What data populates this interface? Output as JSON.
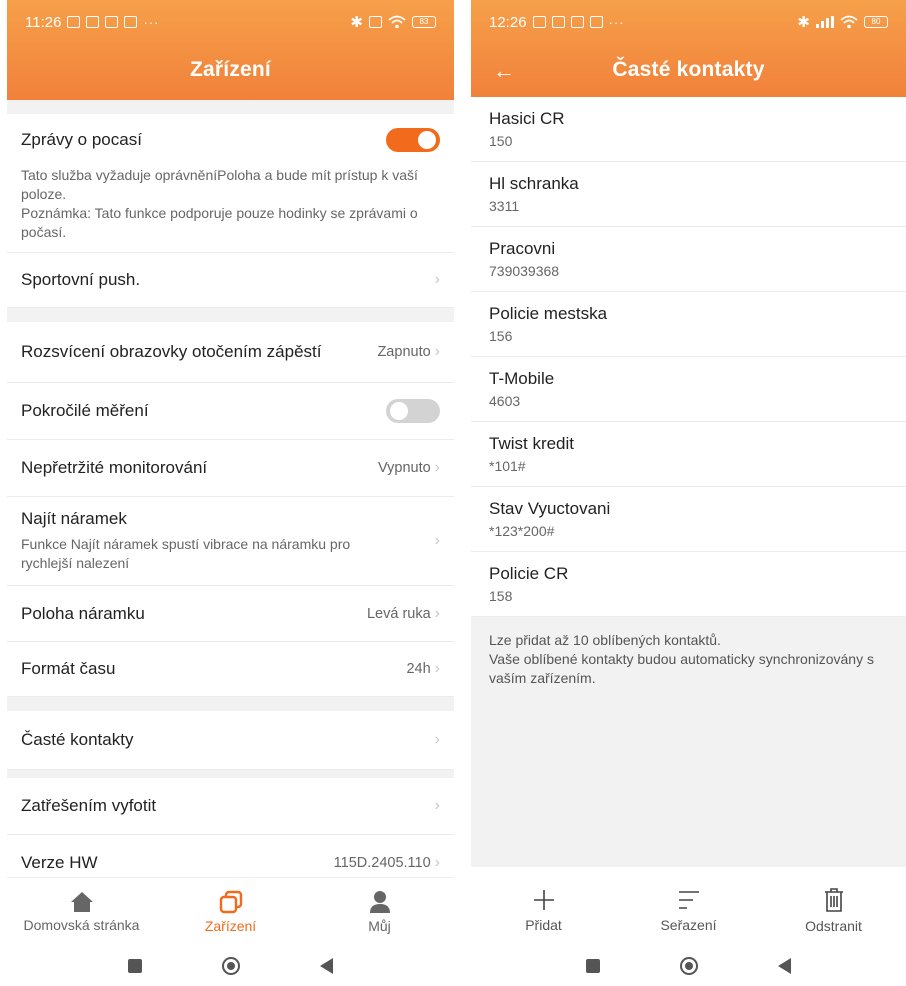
{
  "left": {
    "status": {
      "time": "11:26",
      "more": "···",
      "battery": "83"
    },
    "title": "Zařízení",
    "weather": {
      "label": "Zprávy o pocasí",
      "enabled": true,
      "desc1": "Tato služba vyžaduje oprávněníPoloha a bude mít prístup k vaší poloze.",
      "desc2": "Poznámka: Tato funkce podporuje pouze hodinky se zprávami o počasí."
    },
    "sport_push": {
      "label": "Sportovní push."
    },
    "wrist_wake": {
      "label": "Rozsvícení obrazovky otočením zápěstí",
      "value": "Zapnuto"
    },
    "advanced": {
      "label": "Pokročilé měření",
      "enabled": false
    },
    "monitoring": {
      "label": "Nepřetržité monitorování",
      "value": "Vypnuto"
    },
    "find_band": {
      "label": "Najít náramek",
      "desc": "Funkce Najít náramek spustí vibrace na náramku pro rychlejší nalezení"
    },
    "band_position": {
      "label": "Poloha náramku",
      "value": "Levá ruka"
    },
    "time_format": {
      "label": "Formát času",
      "value": "24h"
    },
    "frequent_contacts": {
      "label": "Časté kontakty"
    },
    "shake_photo": {
      "label": "Zatřešením vyfotit"
    },
    "hw_version": {
      "label": "Verze HW",
      "value": "115D.2405.110"
    },
    "nav": {
      "home": "Domovská stránka",
      "device": "Zařízení",
      "mine": "Můj"
    }
  },
  "right": {
    "status": {
      "time": "12:26",
      "more": "···",
      "battery": "80"
    },
    "title": "Časté kontakty",
    "contacts": [
      {
        "name": "Hasici CR",
        "number": "150"
      },
      {
        "name": "Hl schranka",
        "number": "3311"
      },
      {
        "name": "Pracovni",
        "number": "739039368"
      },
      {
        "name": "Policie mestska",
        "number": "156"
      },
      {
        "name": "T-Mobile",
        "number": "4603"
      },
      {
        "name": "Twist kredit",
        "number": "*101#"
      },
      {
        "name": "Stav Vyuctovani",
        "number": "*123*200#"
      },
      {
        "name": "Policie CR",
        "number": "158"
      }
    ],
    "info1": "Lze přidat až 10 oblíbených kontaktů.",
    "info2": "Vaše oblíbené kontakty budou automaticky synchronizovány s vaším zařízením.",
    "actions": {
      "add": "Přidat",
      "sort": "Seřazení",
      "delete": "Odstranit"
    }
  },
  "colors": {
    "accent": "#f26a1b",
    "header_top": "#f6a04a",
    "header_bottom": "#f1813a"
  }
}
